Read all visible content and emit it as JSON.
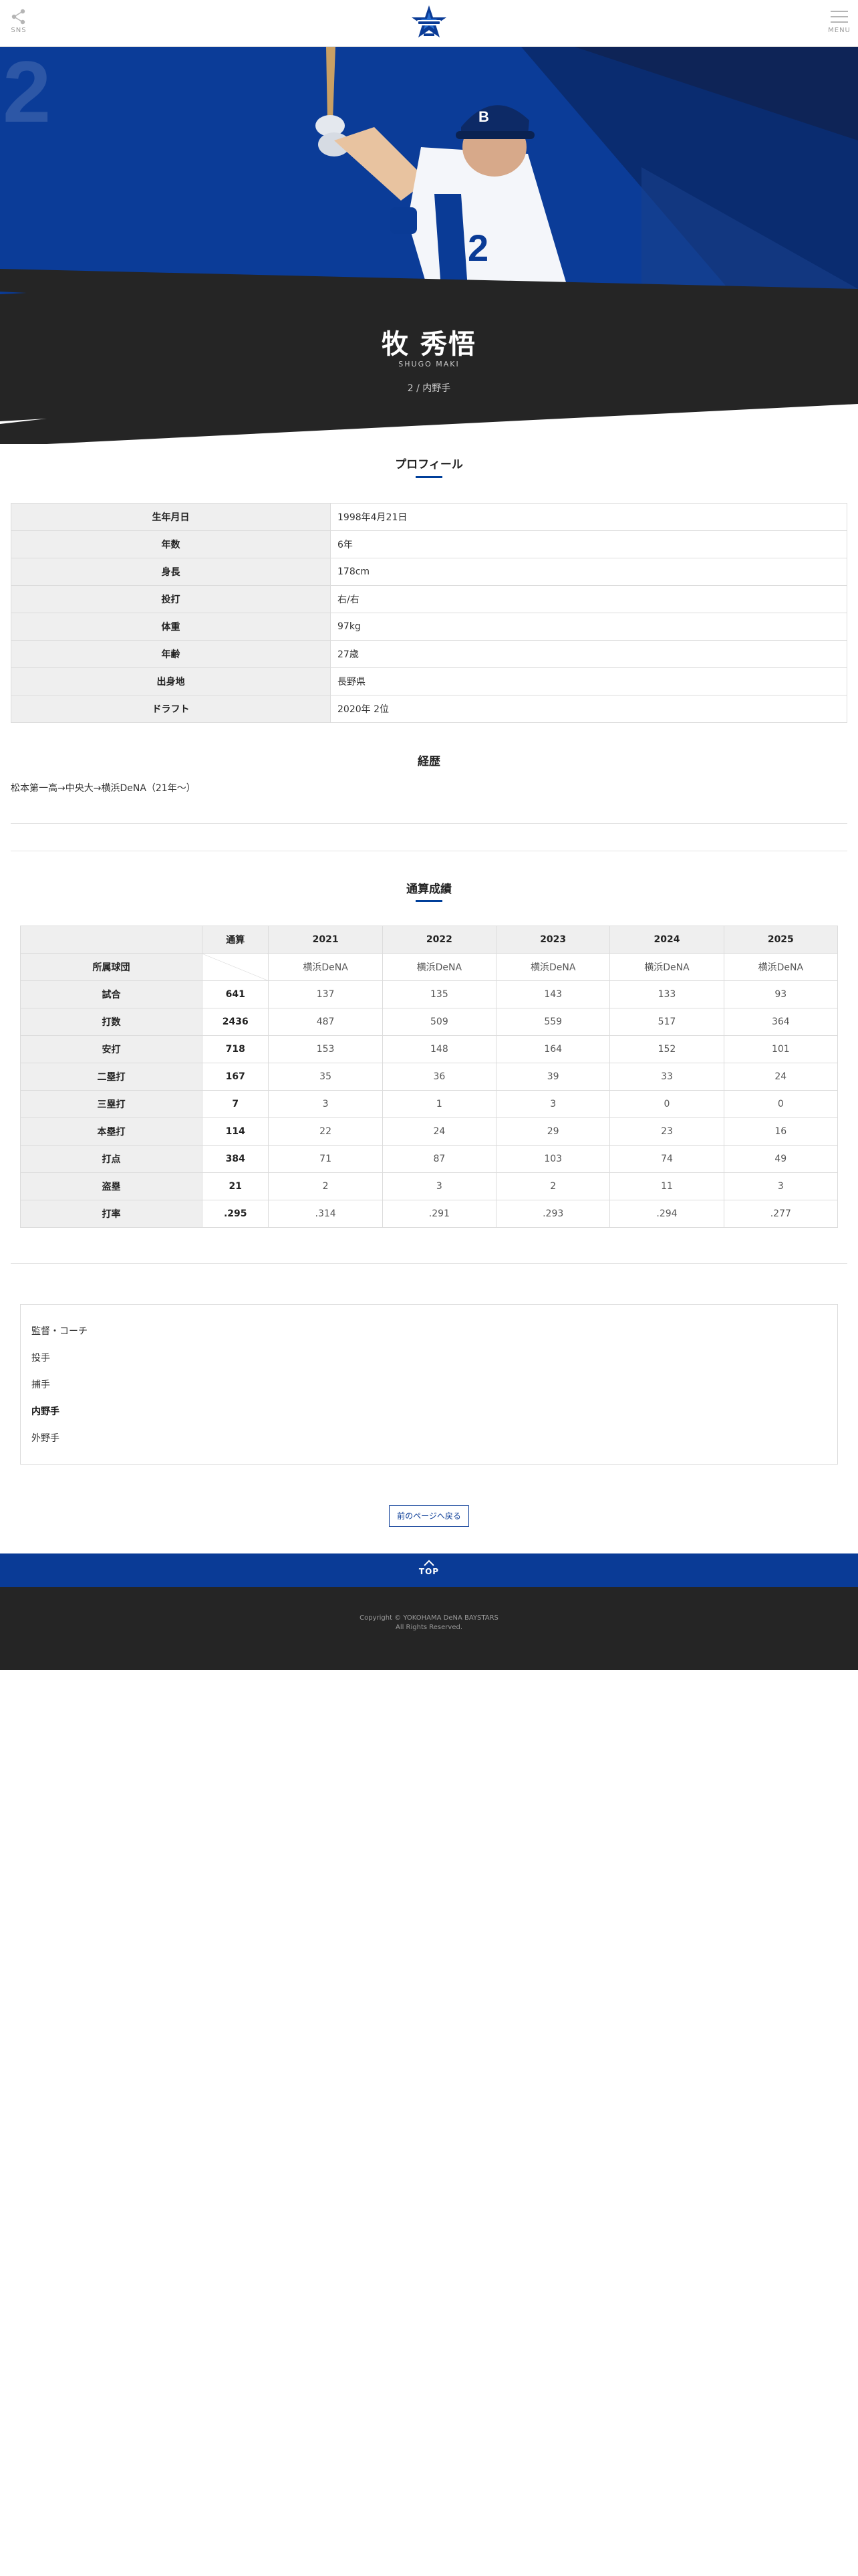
{
  "header": {
    "share_label": "SNS",
    "menu_label": "MENU",
    "logo_icon": "team-star-logo-icon"
  },
  "player": {
    "number": "2",
    "name": "牧 秀悟",
    "name_roman": "SHUGO MAKI",
    "position": "2 / 内野手"
  },
  "profile": {
    "title": "プロフィール",
    "rows": [
      {
        "label": "生年月日",
        "value": "1998年4月21日"
      },
      {
        "label": "年数",
        "value": "6年"
      },
      {
        "label": "身長",
        "value": "178cm"
      },
      {
        "label": "投打",
        "value": "右/右"
      },
      {
        "label": "体重",
        "value": "97kg"
      },
      {
        "label": "年齢",
        "value": "27歳"
      },
      {
        "label": "出身地",
        "value": "長野県"
      },
      {
        "label": "ドラフト",
        "value": "2020年 2位"
      }
    ]
  },
  "career": {
    "title": "経歴",
    "text": "松本第一高→中央大→横浜DeNA（21年〜）"
  },
  "stats": {
    "title": "通算成績",
    "columns": [
      "通算",
      "2021",
      "2022",
      "2023",
      "2024",
      "2025"
    ],
    "rows": [
      {
        "label": "所属球団",
        "cells": [
          "",
          "横浜DeNA",
          "横浜DeNA",
          "横浜DeNA",
          "横浜DeNA",
          "横浜DeNA"
        ]
      },
      {
        "label": "試合",
        "cells": [
          "641",
          "137",
          "135",
          "143",
          "133",
          "93"
        ]
      },
      {
        "label": "打数",
        "cells": [
          "2436",
          "487",
          "509",
          "559",
          "517",
          "364"
        ]
      },
      {
        "label": "安打",
        "cells": [
          "718",
          "153",
          "148",
          "164",
          "152",
          "101"
        ]
      },
      {
        "label": "二塁打",
        "cells": [
          "167",
          "35",
          "36",
          "39",
          "33",
          "24"
        ]
      },
      {
        "label": "三塁打",
        "cells": [
          "7",
          "3",
          "1",
          "3",
          "0",
          "0"
        ]
      },
      {
        "label": "本塁打",
        "cells": [
          "114",
          "22",
          "24",
          "29",
          "23",
          "16"
        ]
      },
      {
        "label": "打点",
        "cells": [
          "384",
          "71",
          "87",
          "103",
          "74",
          "49"
        ]
      },
      {
        "label": "盗塁",
        "cells": [
          "21",
          "2",
          "3",
          "2",
          "11",
          "3"
        ]
      },
      {
        "label": "打率",
        "cells": [
          ".295",
          ".314",
          ".291",
          ".293",
          ".294",
          ".277"
        ]
      }
    ]
  },
  "categories": [
    {
      "label": "監督・コーチ",
      "active": false
    },
    {
      "label": "投手",
      "active": false
    },
    {
      "label": "捕手",
      "active": false
    },
    {
      "label": "内野手",
      "active": true
    },
    {
      "label": "外野手",
      "active": false
    }
  ],
  "back_button": "前のページへ戻る",
  "top_button": "TOP",
  "footer": {
    "copyright": "Copyright © YOKOHAMA DeNA BAYSTARS",
    "rights": "All Rights Reserved."
  },
  "colors": {
    "brand_blue": "#0a3b96",
    "dark_band": "#252525",
    "accent_line": "#003f9a"
  }
}
